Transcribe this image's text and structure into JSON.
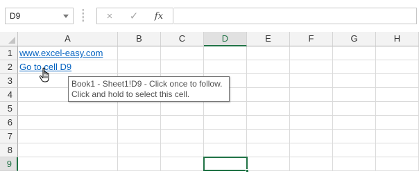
{
  "formula_bar": {
    "name_box": "D9",
    "cancel_icon": "×",
    "enter_icon": "✓",
    "function_label": "fx",
    "formula": ""
  },
  "columns": [
    {
      "label": "A",
      "active": false
    },
    {
      "label": "B",
      "active": false
    },
    {
      "label": "C",
      "active": false
    },
    {
      "label": "D",
      "active": true
    },
    {
      "label": "E",
      "active": false
    },
    {
      "label": "F",
      "active": false
    },
    {
      "label": "G",
      "active": false
    },
    {
      "label": "H",
      "active": false
    }
  ],
  "rows": [
    {
      "label": "1",
      "active": false,
      "a_value": "www.excel-easy.com",
      "a_is_link": true
    },
    {
      "label": "2",
      "active": false,
      "a_value": "Go to cell D9",
      "a_is_link": true
    },
    {
      "label": "3",
      "active": false,
      "a_value": "",
      "a_is_link": false
    },
    {
      "label": "4",
      "active": false,
      "a_value": "",
      "a_is_link": false
    },
    {
      "label": "5",
      "active": false,
      "a_value": "",
      "a_is_link": false
    },
    {
      "label": "6",
      "active": false,
      "a_value": "",
      "a_is_link": false
    },
    {
      "label": "7",
      "active": false,
      "a_value": "",
      "a_is_link": false
    },
    {
      "label": "8",
      "active": false,
      "a_value": "",
      "a_is_link": false
    },
    {
      "label": "9",
      "active": true,
      "a_value": "",
      "a_is_link": false
    }
  ],
  "selected_cell": "D9",
  "tooltip": {
    "line1": "Book1 - Sheet1!D9 - Click once to follow.",
    "line2": "Click and hold to select this cell."
  },
  "colors": {
    "accent": "#217346",
    "link": "#0563c1"
  },
  "cursor_icon": "hand-pointer-icon"
}
